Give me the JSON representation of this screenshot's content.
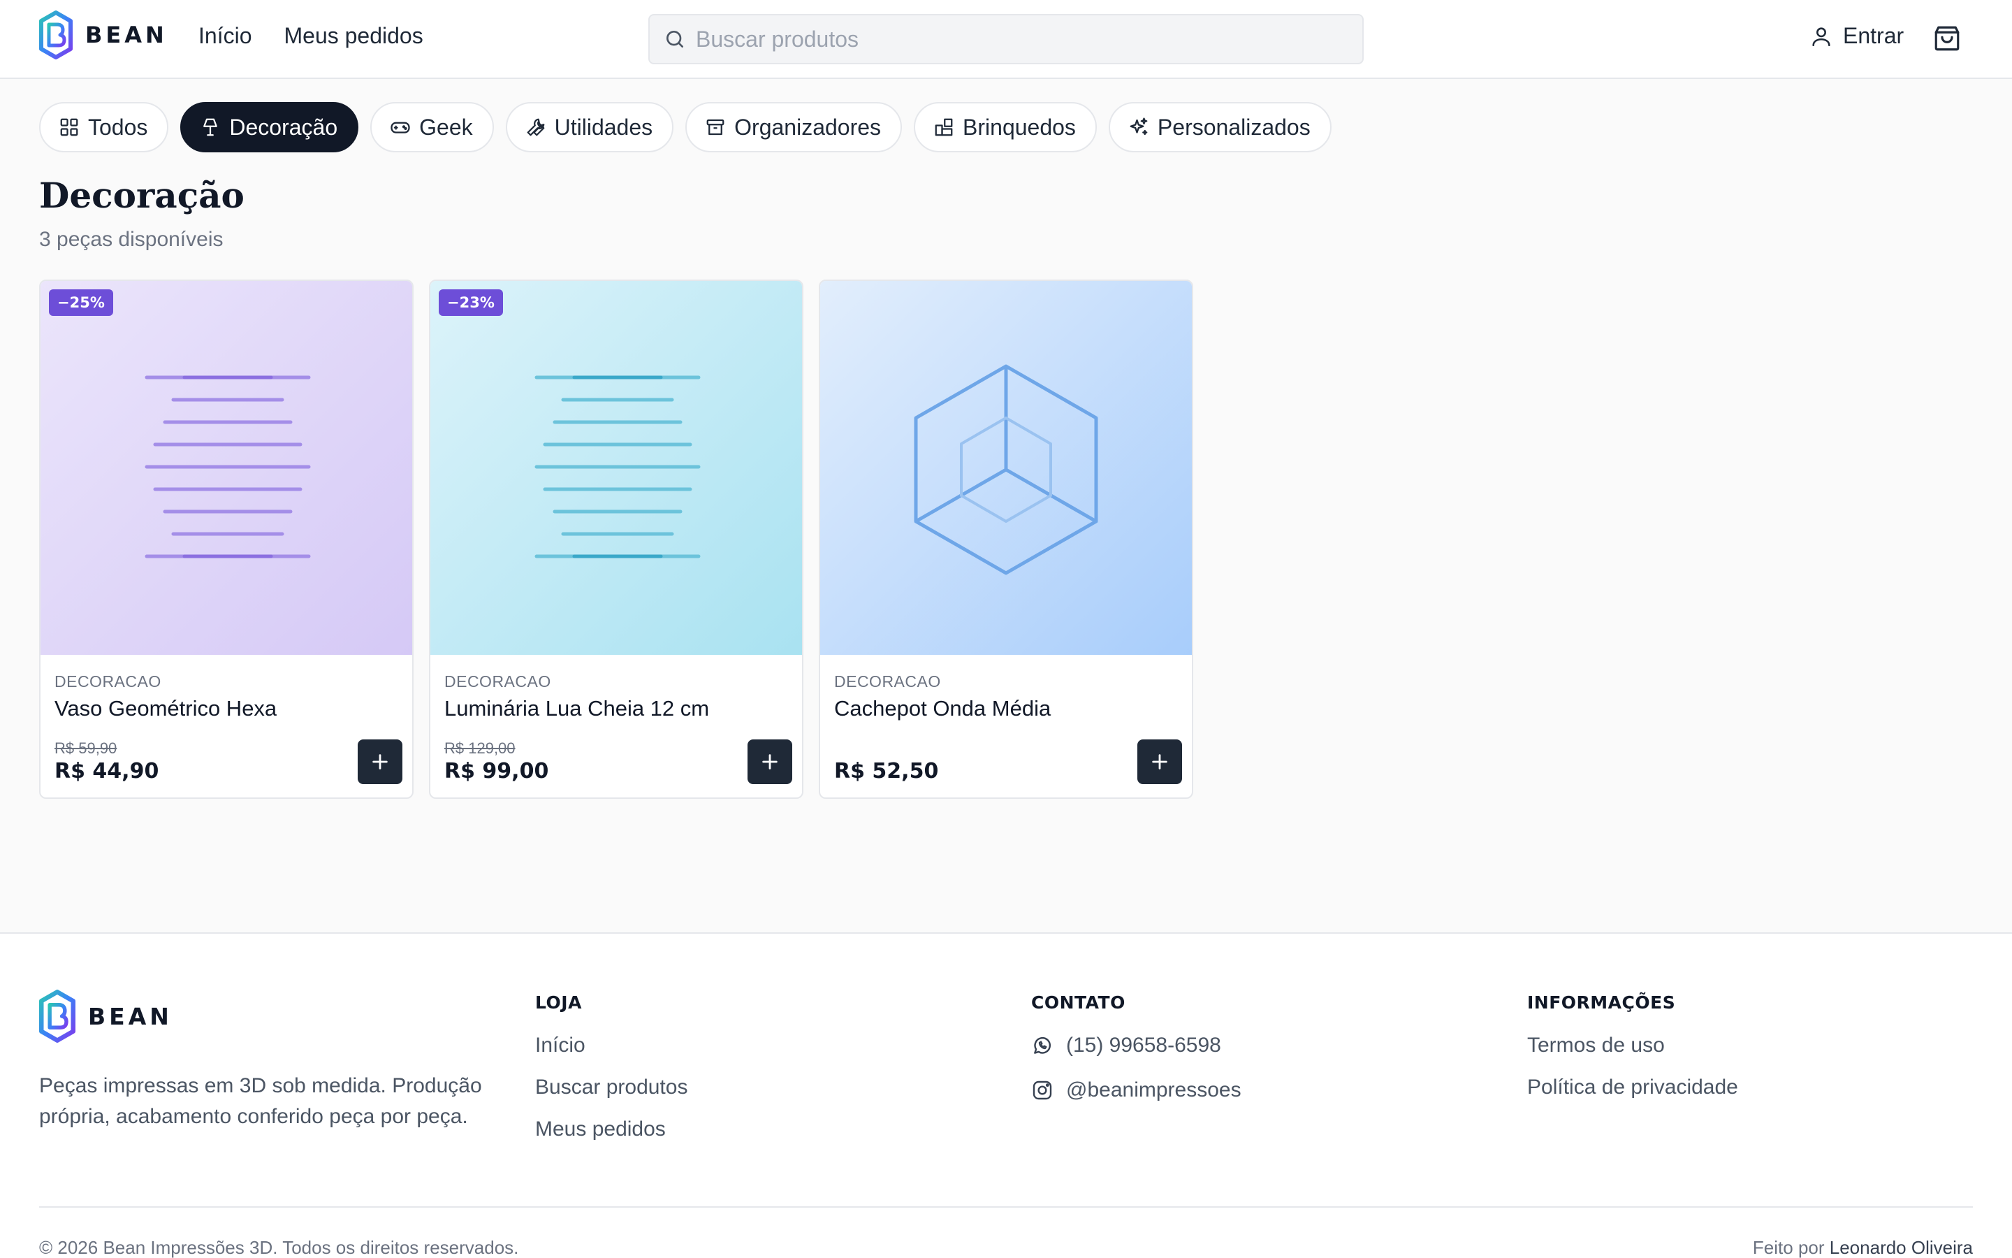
{
  "header": {
    "brand": "BEAN",
    "nav": [
      "Início",
      "Meus pedidos"
    ],
    "search_placeholder": "Buscar produtos",
    "login_label": "Entrar"
  },
  "categories": [
    {
      "label": "Todos",
      "icon": "grid-icon",
      "active": false
    },
    {
      "label": "Decoração",
      "icon": "lamp-icon",
      "active": true
    },
    {
      "label": "Geek",
      "icon": "gamepad-icon",
      "active": false
    },
    {
      "label": "Utilidades",
      "icon": "wrench-icon",
      "active": false
    },
    {
      "label": "Organizadores",
      "icon": "archive-icon",
      "active": false
    },
    {
      "label": "Brinquedos",
      "icon": "blocks-icon",
      "active": false
    },
    {
      "label": "Personalizados",
      "icon": "sparkles-icon",
      "active": false
    }
  ],
  "section": {
    "title": "Decoração",
    "subtitle": "3 peças disponíveis"
  },
  "products": [
    {
      "badge": "−25%",
      "category": "DECORACAO",
      "name": "Vaso Geométrico Hexa",
      "old_price": "R$ 59,90",
      "price": "R$ 44,90",
      "color": "#8b6fe0"
    },
    {
      "badge": "−23%",
      "category": "DECORACAO",
      "name": "Luminária Lua Cheia 12 cm",
      "old_price": "R$ 129,00",
      "price": "R$ 99,00",
      "color": "#3aa8c9"
    },
    {
      "badge": "",
      "category": "DECORACAO",
      "name": "Cachepot Onda Média",
      "old_price": "",
      "price": "R$ 52,50",
      "color": "#5b9be6"
    }
  ],
  "footer": {
    "brand": "BEAN",
    "description": "Peças impressas em 3D sob medida. Produção própria, acabamento conferido peça por peça.",
    "store": {
      "title": "LOJA",
      "links": [
        "Início",
        "Buscar produtos",
        "Meus pedidos"
      ]
    },
    "contact": {
      "title": "CONTATO",
      "phone": "(15) 99658-6598",
      "instagram": "@beanimpressoes"
    },
    "info": {
      "title": "INFORMAÇÕES",
      "links": [
        "Termos de uso",
        "Política de privacidade"
      ]
    },
    "copyright": "© 2026 Bean Impressões 3D. Todos os direitos reservados.",
    "made_by_prefix": "Feito por",
    "made_by_name": "Leonardo Oliveira"
  }
}
